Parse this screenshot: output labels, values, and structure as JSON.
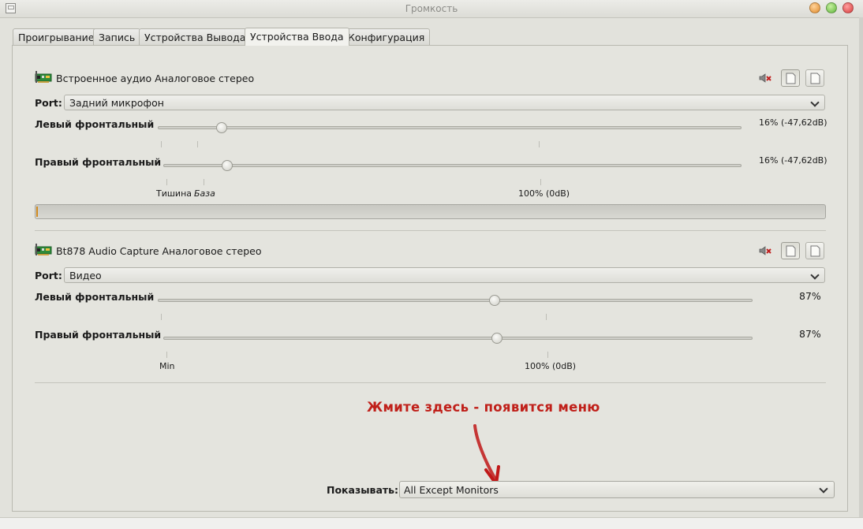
{
  "window": {
    "title": "Громкость"
  },
  "tabs": [
    {
      "label": "Проигрывание"
    },
    {
      "label": "Запись"
    },
    {
      "label": "Устройства Вывода"
    },
    {
      "label": "Устройства Ввода"
    },
    {
      "label": "Конфигурация"
    }
  ],
  "active_tab": "Устройства Ввода",
  "devices": [
    {
      "name": "Встроенное аудио Аналоговое стерео",
      "port_label": "Port:",
      "port_value": "Задний микрофон",
      "channels": [
        {
          "label": "Левый фронтальный",
          "value_text": "16% (-47,62dB)",
          "level": 0.16
        },
        {
          "label": "Правый фронтальный",
          "value_text": "16% (-47,62dB)",
          "level": 0.16
        }
      ],
      "scale_marks": {
        "silence": "Тишина",
        "base": "База",
        "full": "100% (0dB)"
      },
      "vu_level": 0.002
    },
    {
      "name": "Bt878 Audio Capture Аналоговое стерео",
      "port_label": "Port:",
      "port_value": "Видео",
      "channels": [
        {
          "label": "Левый фронтальный",
          "value_text": "87%",
          "level": 0.87
        },
        {
          "label": "Правый фронтальный",
          "value_text": "87%",
          "level": 0.87
        }
      ],
      "scale_marks": {
        "min": "Min",
        "full": "100% (0dB)"
      }
    }
  ],
  "annotation": "Жмите здесь - появится меню",
  "show_filter": {
    "label": "Показывать:",
    "value": "All Except Monitors"
  },
  "colors": {
    "annotation": "#c0201a",
    "vu_fill": "#d08a1e"
  },
  "icons": {
    "device": "sound-card-icon",
    "mute": "speaker-mute-icon",
    "lock": "lock-channels-icon",
    "default": "set-default-icon"
  }
}
